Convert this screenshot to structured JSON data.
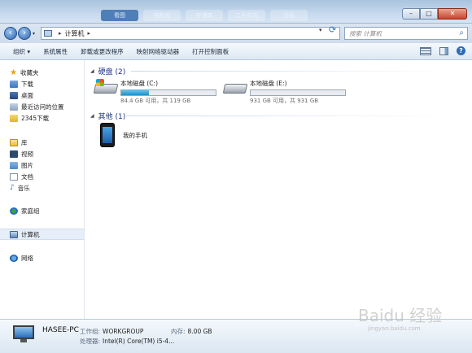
{
  "window": {
    "background_tabs": [
      "看图",
      "电影库",
      "存储库",
      "二手市场",
      "论坛"
    ]
  },
  "address": {
    "crumb": "计算机",
    "search_placeholder": "搜索 计算机"
  },
  "toolbar": {
    "items": [
      "组织 ▾",
      "系统属性",
      "卸载或更改程序",
      "映射网络驱动器",
      "打开控制面板"
    ]
  },
  "nav": {
    "favorites": "收藏夹",
    "fav_items": [
      "下载",
      "桌面",
      "最近访问的位置",
      "2345下载"
    ],
    "libraries": "库",
    "lib_items": [
      "视频",
      "图片",
      "文档",
      "音乐"
    ],
    "homegroup": "家庭组",
    "computer": "计算机",
    "network": "网络"
  },
  "content": {
    "hdd_group": "硬盘 (2)",
    "drives": [
      {
        "name": "本地磁盘 (C:)",
        "free_text": "84.4 GB 可用，共 119 GB",
        "used_fraction": 0.29
      },
      {
        "name": "本地磁盘 (E:)",
        "free_text": "931 GB 可用，共 931 GB",
        "used_fraction": 0.0
      }
    ],
    "other_group": "其他 (1)",
    "device_name": "我的手机"
  },
  "details": {
    "pc_name": "HASEE-PC",
    "workgroup_label": "工作组:",
    "workgroup_value": "WORKGROUP",
    "memory_label": "内存:",
    "memory_value": "8.00 GB",
    "cpu_label": "处理器:",
    "cpu_value": "Intel(R) Core(TM) i5-4..."
  },
  "watermark": {
    "main": "Baidu 经验",
    "sub": "jingyan.baidu.com"
  }
}
